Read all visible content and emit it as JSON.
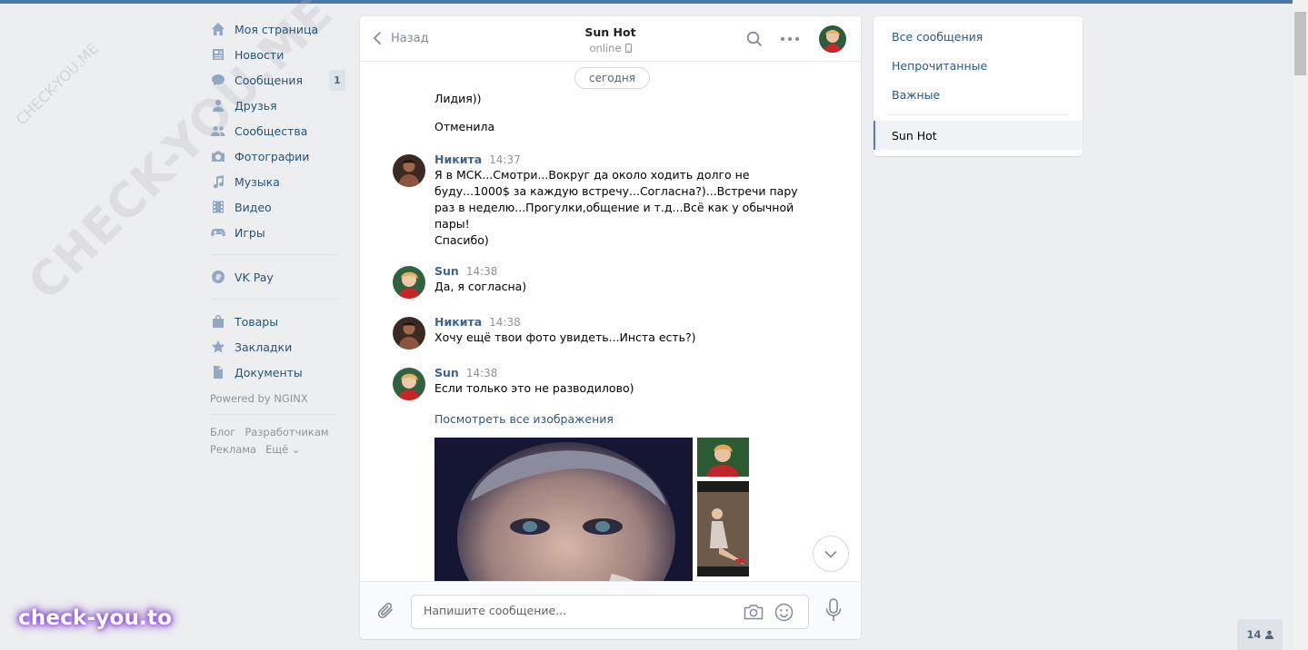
{
  "left_nav": {
    "items": [
      {
        "label": "Моя страница",
        "icon": "home-icon"
      },
      {
        "label": "Новости",
        "icon": "news-icon"
      },
      {
        "label": "Сообщения",
        "icon": "messages-icon",
        "badge": "1"
      },
      {
        "label": "Друзья",
        "icon": "friends-icon"
      },
      {
        "label": "Сообщества",
        "icon": "communities-icon"
      },
      {
        "label": "Фотографии",
        "icon": "camera-icon"
      },
      {
        "label": "Музыка",
        "icon": "music-icon"
      },
      {
        "label": "Видео",
        "icon": "video-icon"
      },
      {
        "label": "Игры",
        "icon": "gamepad-icon"
      }
    ],
    "pay_item": {
      "label": "VK Pay",
      "icon": "vkpay-icon"
    },
    "extra_items": [
      {
        "label": "Товары",
        "icon": "bag-icon"
      },
      {
        "label": "Закладки",
        "icon": "star-icon"
      },
      {
        "label": "Документы",
        "icon": "document-icon"
      }
    ],
    "powered": "Powered by NGINX",
    "footer": [
      "Блог",
      "Разработчикам",
      "Реклама",
      "Ещё ⌄"
    ]
  },
  "chat": {
    "back_label": "Назад",
    "peer_name": "Sun Hot",
    "peer_status": "online",
    "date_divider": "сегодня",
    "pre_messages": [
      "Лидия))",
      "Отменила"
    ],
    "messages": [
      {
        "author": "Никита",
        "time": "14:37",
        "lines": [
          "Я в МСК...Смотри...Вокруг да около ходить долго не буду...1000$ за каждую встречу...Согласна?)...Встречи пару раз в неделю...Прогулки,общение и т.д...Всё как у обычной пары!",
          "Спасибо)"
        ]
      },
      {
        "author": "Sun",
        "time": "14:38",
        "lines": [
          "Да, я согласна)"
        ]
      },
      {
        "author": "Никита",
        "time": "14:38",
        "lines": [
          "Хочу ещё твои фото увидеть...Инста есть?)"
        ]
      },
      {
        "author": "Sun",
        "time": "14:38",
        "lines": [
          "Если только это не разводилово)"
        ]
      }
    ],
    "view_all_images": "Посмотреть все изображения",
    "composer_placeholder": "Напишите сообщение..."
  },
  "right_nav": {
    "items": [
      "Все сообщения",
      "Непрочитанные",
      "Важные"
    ],
    "active": "Sun Hot"
  },
  "online_count": "14",
  "watermark": {
    "big": "CHECK-YOU.ME",
    "small": "CHECK-YOU.ME",
    "brand": "check-you.to"
  },
  "colors": {
    "accent": "#4a76a8",
    "link": "#2a5885",
    "author": "#42648b",
    "background": "#edeef0"
  }
}
